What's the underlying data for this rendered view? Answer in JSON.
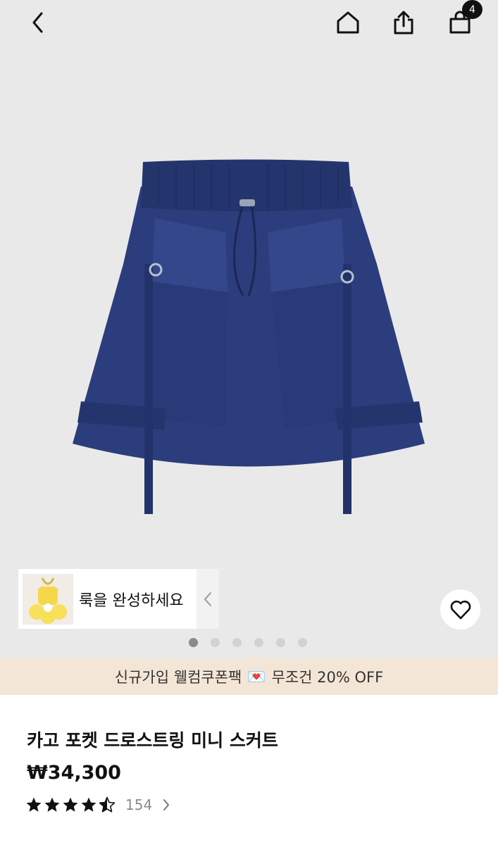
{
  "header": {
    "back_icon": "chevron-left-icon",
    "home_icon": "home-icon",
    "share_icon": "share-icon",
    "cart_icon": "shopping-bag-icon",
    "cart_count": "4"
  },
  "gallery": {
    "image_count": 6,
    "active_index": 0,
    "look": {
      "label": "룩을 완성하세요"
    }
  },
  "promo": {
    "text_before": "신규가입 웰컴쿠폰팩",
    "emoji": "💌",
    "text_after": "무조건 20% OFF"
  },
  "product": {
    "title": "카고 포켓 드로스트링 미니 스커트",
    "price": "₩34,300",
    "rating": 4.5,
    "review_count": "154"
  },
  "colors": {
    "skirt": "#2b3d7c",
    "promo_bg": "#f4e6d6",
    "gallery_bg": "#e9e9e9"
  }
}
